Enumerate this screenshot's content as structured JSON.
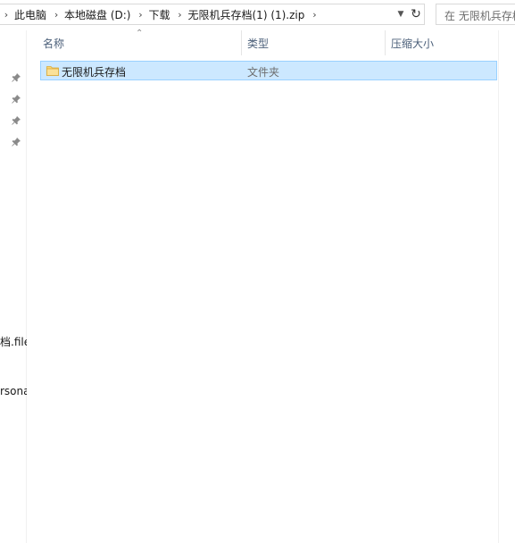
{
  "address_bar": {
    "breadcrumbs": [
      "此电脑",
      "本地磁盘 (D:)",
      "下载",
      "无限机兵存档(1) (1).zip"
    ]
  },
  "search": {
    "placeholder": "在 无限机兵存档"
  },
  "nav_pane": {
    "fragments": [
      "档.file",
      "rsona"
    ]
  },
  "columns": [
    "名称",
    "类型",
    "压缩大小"
  ],
  "files": [
    {
      "name": "无限机兵存档",
      "type": "文件夹",
      "size": ""
    }
  ],
  "colors": {
    "selection_bg": "#cce8ff",
    "selection_border": "#99d1ff",
    "folder": "#f8d775"
  }
}
